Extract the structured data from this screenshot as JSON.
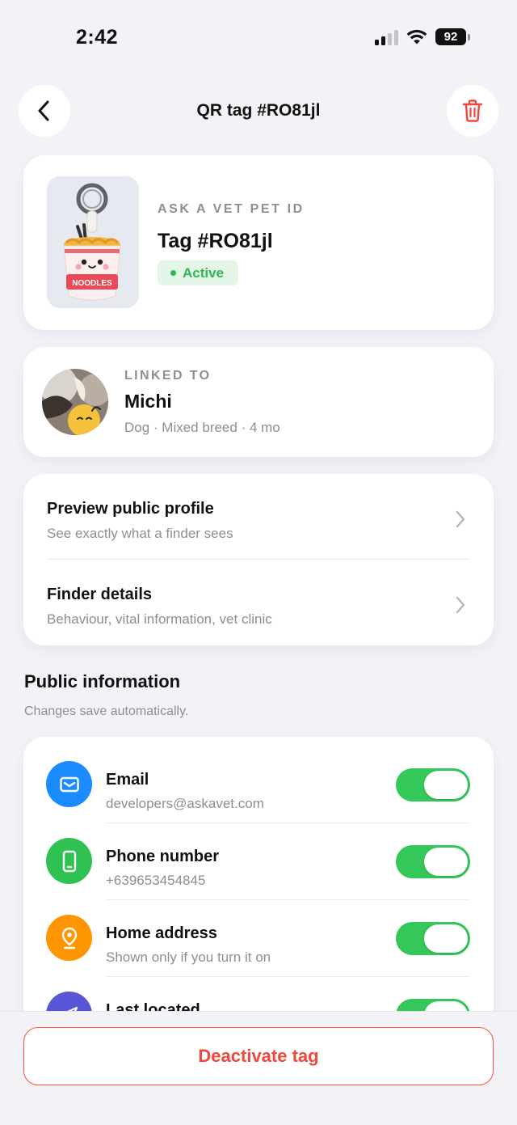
{
  "status_bar": {
    "time": "2:42",
    "battery": "92"
  },
  "nav": {
    "title": "QR tag #RO81jl",
    "back_icon": "chevron-left-icon",
    "delete_icon": "trash-icon"
  },
  "tag_card": {
    "eyebrow": "ASK A VET PET ID",
    "name": "Tag #RO81jl",
    "status": "Active",
    "thumbnail_text": "NOODLES"
  },
  "linked_card": {
    "eyebrow": "LINKED TO",
    "pet_name": "Michi",
    "pet_meta": "Dog · Mixed breed · 4 mo"
  },
  "links": [
    {
      "title": "Preview public profile",
      "subtitle": "See exactly what a finder sees"
    },
    {
      "title": "Finder details",
      "subtitle": "Behaviour, vital information, vet clinic"
    }
  ],
  "public_info": {
    "title": "Public information",
    "subtitle": "Changes save automatically.",
    "items": [
      {
        "title": "Email",
        "subtitle": "developers@askavet.com",
        "icon": "mail-icon",
        "color": "#1a8cff",
        "enabled": true
      },
      {
        "title": "Phone number",
        "subtitle": "+639653454845",
        "icon": "phone-icon",
        "color": "#30c153",
        "enabled": true
      },
      {
        "title": "Home address",
        "subtitle": "Shown only if you turn it on",
        "icon": "map-pin-icon",
        "color": "#ff9500",
        "enabled": true
      },
      {
        "title": "Last located",
        "subtitle": "",
        "icon": "location-arrow-icon",
        "color": "#5856d6",
        "enabled": true
      }
    ]
  },
  "actions": {
    "deactivate": "Deactivate tag"
  },
  "colors": {
    "accent_green": "#34c759",
    "danger": "#f2473d",
    "background": "#f2f2f7"
  }
}
